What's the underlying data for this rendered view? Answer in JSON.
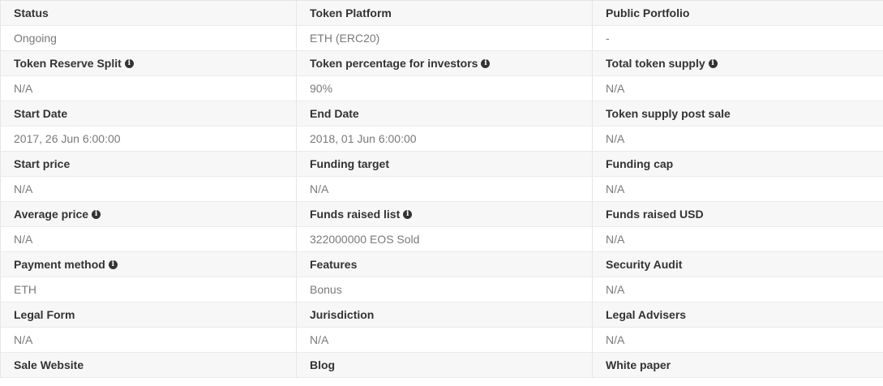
{
  "rows": [
    {
      "labels": [
        {
          "text": "Status",
          "info": false
        },
        {
          "text": "Token Platform",
          "info": false
        },
        {
          "text": "Public Portfolio",
          "info": false
        }
      ],
      "values": [
        "Ongoing",
        "ETH (ERC20)",
        "-"
      ]
    },
    {
      "labels": [
        {
          "text": "Token Reserve Split",
          "info": true
        },
        {
          "text": "Token percentage for investors",
          "info": true
        },
        {
          "text": "Total token supply",
          "info": true
        }
      ],
      "values": [
        "N/A",
        "90%",
        "N/A"
      ]
    },
    {
      "labels": [
        {
          "text": "Start Date",
          "info": false
        },
        {
          "text": "End Date",
          "info": false
        },
        {
          "text": "Token supply post sale",
          "info": false
        }
      ],
      "values": [
        "2017, 26 Jun 6:00:00",
        "2018, 01 Jun 6:00:00",
        "N/A"
      ]
    },
    {
      "labels": [
        {
          "text": "Start price",
          "info": false
        },
        {
          "text": "Funding target",
          "info": false
        },
        {
          "text": "Funding cap",
          "info": false
        }
      ],
      "values": [
        "N/A",
        "N/A",
        "N/A"
      ]
    },
    {
      "labels": [
        {
          "text": "Average price",
          "info": true
        },
        {
          "text": "Funds raised list",
          "info": true
        },
        {
          "text": "Funds raised USD",
          "info": false
        }
      ],
      "values": [
        "N/A",
        "322000000 EOS Sold",
        "N/A"
      ]
    },
    {
      "labels": [
        {
          "text": "Payment method",
          "info": true
        },
        {
          "text": "Features",
          "info": false
        },
        {
          "text": "Security Audit",
          "info": false
        }
      ],
      "values": [
        "ETH",
        "Bonus",
        "N/A"
      ]
    },
    {
      "labels": [
        {
          "text": "Legal Form",
          "info": false
        },
        {
          "text": "Jurisdiction",
          "info": false
        },
        {
          "text": "Legal Advisers",
          "info": false
        }
      ],
      "values": [
        "N/A",
        "N/A",
        "N/A"
      ]
    },
    {
      "labels": [
        {
          "text": "Sale Website",
          "info": false
        },
        {
          "text": "Blog",
          "info": false
        },
        {
          "text": "White paper",
          "info": false
        }
      ],
      "values": [
        "",
        "",
        ""
      ]
    }
  ],
  "icons": {
    "info": "info-circle-icon",
    "info_glyph": "i"
  }
}
